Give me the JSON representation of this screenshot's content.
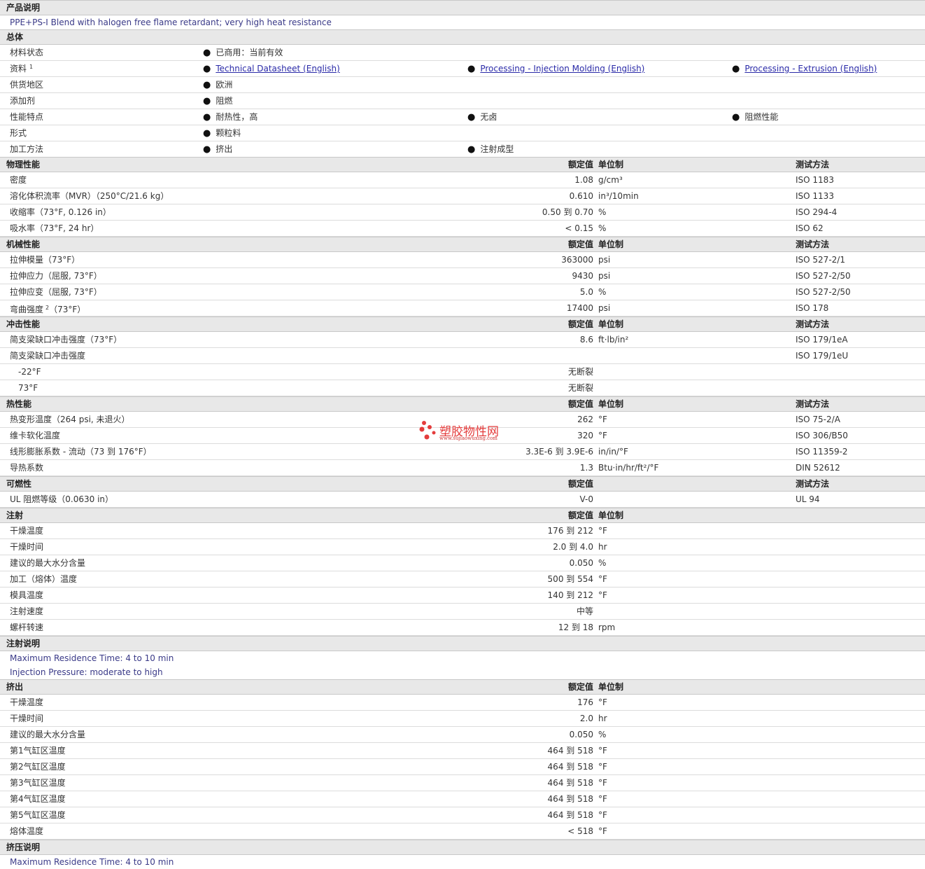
{
  "headers": {
    "value": "额定值",
    "unit": "单位制",
    "method": "测试方法"
  },
  "desc": {
    "title": "产品说明",
    "text": "PPE+PS-I Blend with halogen free flame retardant; very high heat resistance"
  },
  "general": {
    "title": "总体",
    "rows": [
      {
        "label": "材料状态",
        "items": [
          "已商用：当前有效"
        ]
      },
      {
        "label": "资料",
        "sup": "1",
        "items": [
          "Technical Datasheet (English)",
          "Processing - Injection Molding (English)",
          "Processing - Extrusion (English)"
        ]
      },
      {
        "label": "供货地区",
        "items": [
          "欧洲"
        ]
      },
      {
        "label": "添加剂",
        "items": [
          "阻燃"
        ]
      },
      {
        "label": "性能特点",
        "items": [
          "耐热性，高",
          "无卤",
          "阻燃性能"
        ]
      },
      {
        "label": "形式",
        "items": [
          "颗粒料"
        ]
      },
      {
        "label": "加工方法",
        "items": [
          "挤出",
          "注射成型"
        ]
      }
    ]
  },
  "physical": {
    "title": "物理性能",
    "rows": [
      {
        "label": "密度",
        "value": "1.08",
        "unit": "g/cm³",
        "method": "ISO 1183"
      },
      {
        "label": "溶化体积流率（MVR）（250°C/21.6 kg）",
        "value": "0.610",
        "unit": "in³/10min",
        "method": "ISO 1133"
      },
      {
        "label": "收缩率（73°F, 0.126 in）",
        "value": "0.50 到  0.70",
        "unit": "%",
        "method": "ISO 294-4"
      },
      {
        "label": "吸水率（73°F, 24 hr）",
        "value": "< 0.15",
        "unit": "%",
        "method": "ISO 62"
      }
    ]
  },
  "mechanical": {
    "title": "机械性能",
    "rows": [
      {
        "label": "拉伸模量（73°F）",
        "value": "363000",
        "unit": "psi",
        "method": "ISO 527-2/1"
      },
      {
        "label": "拉伸应力（屈服, 73°F）",
        "value": "9430",
        "unit": "psi",
        "method": "ISO 527-2/50"
      },
      {
        "label": "拉伸应变（屈服, 73°F）",
        "value": "5.0",
        "unit": "%",
        "method": "ISO 527-2/50"
      },
      {
        "label": "弯曲强度",
        "sup": "2",
        "label2": "（73°F）",
        "value": "17400",
        "unit": "psi",
        "method": "ISO 178"
      }
    ]
  },
  "impact": {
    "title": "冲击性能",
    "rows": [
      {
        "label": "简支梁缺口冲击强度（73°F）",
        "value": "8.6",
        "unit": "ft·lb/in²",
        "method": "ISO 179/1eA"
      },
      {
        "label": "简支梁缺口冲击强度",
        "value": "",
        "unit": "",
        "method": "ISO 179/1eU"
      },
      {
        "label": "-22°F",
        "indent": true,
        "value": "无断裂",
        "unit": "",
        "method": ""
      },
      {
        "label": "73°F",
        "indent": true,
        "value": "无断裂",
        "unit": "",
        "method": ""
      }
    ]
  },
  "thermal": {
    "title": "热性能",
    "rows": [
      {
        "label": "热变形温度（264 psi, 未退火）",
        "value": "262",
        "unit": "°F",
        "method": "ISO 75-2/A"
      },
      {
        "label": "维卡软化温度",
        "value": "320",
        "unit": "°F",
        "method": "ISO 306/B50"
      },
      {
        "label": "线形膨胀系数 - 流动（73 到 176°F）",
        "value": "3.3E-6 到  3.9E-6",
        "unit": "in/in/°F",
        "method": "ISO 11359-2"
      },
      {
        "label": "导热系数",
        "value": "1.3",
        "unit": "Btu·in/hr/ft²/°F",
        "method": "DIN 52612"
      }
    ]
  },
  "flammability": {
    "title": "可燃性",
    "rows": [
      {
        "label": "UL 阻燃等级（0.0630 in）",
        "value": "V-0",
        "unit": "",
        "method": "UL 94"
      }
    ]
  },
  "injection": {
    "title": "注射",
    "rows": [
      {
        "label": "干燥温度",
        "value": "176 到  212",
        "unit": "°F"
      },
      {
        "label": "干燥时间",
        "value": "2.0 到  4.0",
        "unit": "hr"
      },
      {
        "label": "建议的最大水分含量",
        "value": "0.050",
        "unit": "%"
      },
      {
        "label": "加工（熔体）温度",
        "value": "500 到  554",
        "unit": "°F"
      },
      {
        "label": "模具温度",
        "value": "140 到  212",
        "unit": "°F"
      },
      {
        "label": "注射速度",
        "value": "中等",
        "unit": ""
      },
      {
        "label": "螺杆转速",
        "value": "12 到  18",
        "unit": "rpm"
      }
    ]
  },
  "injection_notes": {
    "title": "注射说明",
    "lines": [
      "Maximum Residence Time: 4 to 10 min",
      "Injection Pressure: moderate to high"
    ]
  },
  "extrusion": {
    "title": "挤出",
    "rows": [
      {
        "label": "干燥温度",
        "value": "176",
        "unit": "°F"
      },
      {
        "label": "干燥时间",
        "value": "2.0",
        "unit": "hr"
      },
      {
        "label": "建议的最大水分含量",
        "value": "0.050",
        "unit": "%"
      },
      {
        "label": "第1气缸区温度",
        "value": "464 到  518",
        "unit": "°F"
      },
      {
        "label": "第2气缸区温度",
        "value": "464 到  518",
        "unit": "°F"
      },
      {
        "label": "第3气缸区温度",
        "value": "464 到  518",
        "unit": "°F"
      },
      {
        "label": "第4气缸区温度",
        "value": "464 到  518",
        "unit": "°F"
      },
      {
        "label": "第5气缸区温度",
        "value": "464 到  518",
        "unit": "°F"
      },
      {
        "label": "熔体温度",
        "value": "< 518",
        "unit": "°F"
      }
    ]
  },
  "extrusion_notes": {
    "title": "挤压说明",
    "lines": [
      "Maximum Residence Time: 4 to 10 min"
    ]
  },
  "watermark": {
    "text": "塑胶物性网",
    "url": "www.sujiaowuxing.com"
  }
}
